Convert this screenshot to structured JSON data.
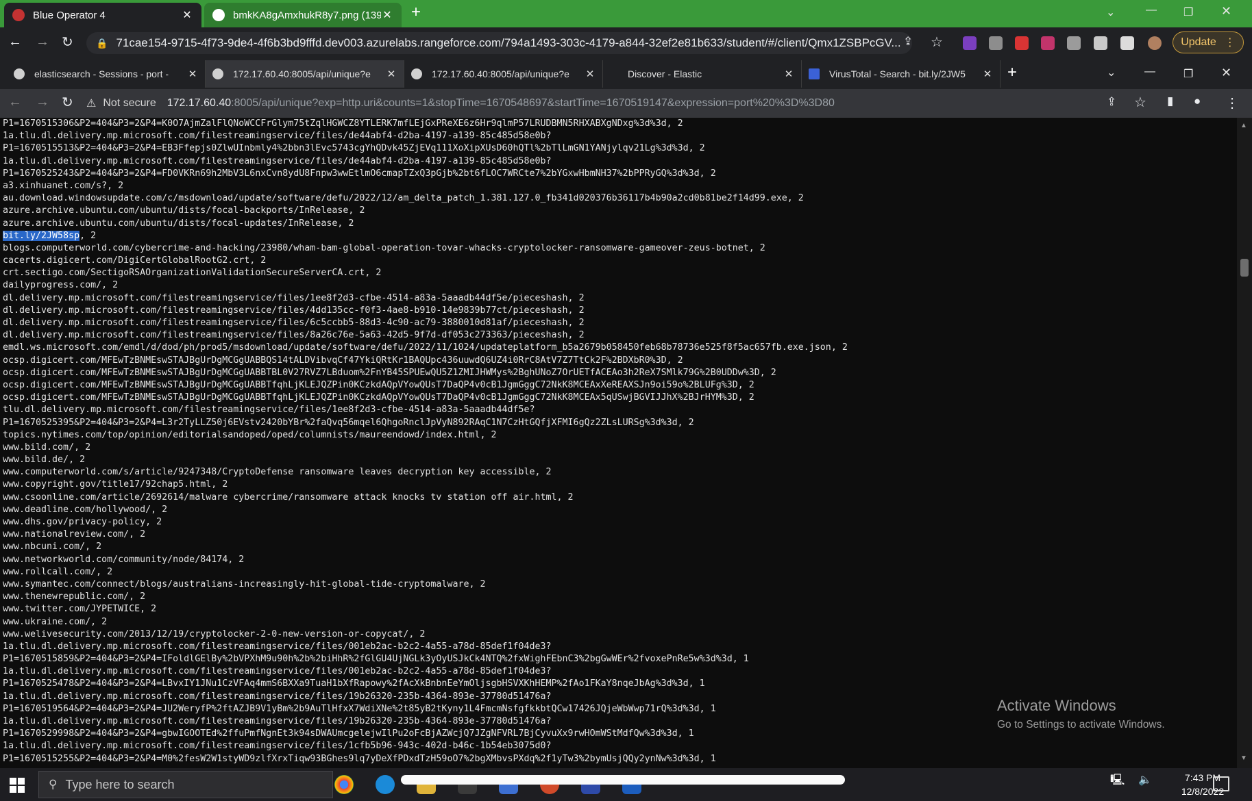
{
  "outer_browser": {
    "tabs": [
      {
        "title": "Blue Operator 4",
        "icon": "rangeforce-icon"
      },
      {
        "title": "bmkKA8gAmxhukR8y7.png (139",
        "icon": "image-icon"
      }
    ],
    "url": "71cae154-9715-4f73-9de4-4f6b3bd9fffd.dev003.azurelabs.rangeforce.com/794a1493-303c-4179-a844-32ef2e81b633/student/#/client/Qmx1ZSBPcGV...",
    "update_label": "Update"
  },
  "inner_browser": {
    "tabs": [
      {
        "title": "elasticsearch - Sessions - port -",
        "icon": "globe-icon"
      },
      {
        "title": "172.17.60.40:8005/api/unique?e",
        "icon": "globe-icon"
      },
      {
        "title": "172.17.60.40:8005/api/unique?e",
        "icon": "globe-icon"
      },
      {
        "title": "Discover - Elastic",
        "icon": "elastic-icon"
      },
      {
        "title": "VirusTotal - Search - bit.ly/2JW5",
        "icon": "virustotal-icon"
      }
    ],
    "security": "Not secure",
    "url_host": "172.17.60.40",
    "url_path": ":8005/api/unique?exp=http.uri&counts=1&stopTime=1670548697&startTime=1670519147&expression=port%20%3D%3D80"
  },
  "page": {
    "lines": [
      "P1=1670515306&P2=404&P3=2&P4=K0O7AjmZalFlQNoWCCFrGlym75tZqlHGWCZ8YTLERK7mfLEjGxPReXE6z6Hr9qlmP57LRUDBMN5RHXABXgNDxg%3d%3d, 2",
      "1a.tlu.dl.delivery.mp.microsoft.com/filestreamingservice/files/de44abf4-d2ba-4197-a139-85c485d58e0b?",
      "P1=1670515513&P2=404&P3=2&P4=EB3Ffepjs0ZlwUInbmly4%2bbn3lEvc5743cgYhQDvk45ZjEVq111XoXipXUsD60hQTl%2bTlLmGN1YANjylqv21Lg%3d%3d, 2",
      "1a.tlu.dl.delivery.mp.microsoft.com/filestreamingservice/files/de44abf4-d2ba-4197-a139-85c485d58e0b?",
      "P1=1670525243&P2=404&P3=2&P4=FD0VKRn69h2MbV3L6nxCvn8ydU8Fnpw3wwEtlmO6cmapTZxQ3pGjb%2bt6fLOC7WRCte7%2bYGxwHbmNH37%2bPPRyGQ%3d%3d, 2",
      "a3.xinhuanet.com/s?, 2",
      "au.download.windowsupdate.com/c/msdownload/update/software/defu/2022/12/am_delta_patch_1.381.127.0_fb341d020376b36117b4b90a2cd0b81be2f14d99.exe, 2",
      "azure.archive.ubuntu.com/ubuntu/dists/focal-backports/InRelease, 2",
      "azure.archive.ubuntu.com/ubuntu/dists/focal-updates/InRelease, 2",
      "bit.ly/2JW58sp",
      "blogs.computerworld.com/cybercrime-and-hacking/23980/wham-bam-global-operation-tovar-whacks-cryptolocker-ransomware-gameover-zeus-botnet, 2",
      "cacerts.digicert.com/DigiCertGlobalRootG2.crt, 2",
      "crt.sectigo.com/SectigoRSAOrganizationValidationSecureServerCA.crt, 2",
      "dailyprogress.com/, 2",
      "dl.delivery.mp.microsoft.com/filestreamingservice/files/1ee8f2d3-cfbe-4514-a83a-5aaadb44df5e/pieceshash, 2",
      "dl.delivery.mp.microsoft.com/filestreamingservice/files/4dd135cc-f0f3-4ae8-b910-14e9839b77ct/pieceshash, 2",
      "dl.delivery.mp.microsoft.com/filestreamingservice/files/6c5ccbb5-88d3-4c90-ac79-3880010d81af/pieceshash, 2",
      "dl.delivery.mp.microsoft.com/filestreamingservice/files/8a26c76e-5a63-42d5-9f7d-df053c273363/pieceshash, 2",
      "emdl.ws.microsoft.com/emdl/d/dod/ph/prod5/msdownload/update/software/defu/2022/11/1024/updateplatform_b5a2679b058450feb68b78736e525f8f5ac657fb.exe.json, 2",
      "ocsp.digicert.com/MFEwTzBNMEswSTAJBgUrDgMCGgUABBQS14tALDVibvqCf47YkiQRtKr1BAQUpc436uuwdQ6UZ4i0RrC8AtV7Z7TtCk2F%2BDXbR0%3D, 2",
      "ocsp.digicert.com/MFEwTzBNMEswSTAJBgUrDgMCGgUABBTBL0V27RVZ7LBduom%2FnYB45SPUEwQU5Z1ZMIJHWMys%2BghUNoZ7OrUETfACEAo3h2ReX7SMlk79G%2B0UDDw%3D, 2",
      "ocsp.digicert.com/MFEwTzBNMEswSTAJBgUrDgMCGgUABBTfqhLjKLEJQZPin0KCzkdAQpVYowQUsT7DaQP4v0cB1JgmGggC72NkK8MCEAxXeREAXSJn9oi59o%2BLUFg%3D, 2",
      "ocsp.digicert.com/MFEwTzBNMEswSTAJBgUrDgMCGgUABBTfqhLjKLEJQZPin0KCzkdAQpVYowQUsT7DaQP4v0cB1JgmGggC72NkK8MCEAx5qUSwjBGVIJJhX%2BJrHYM%3D, 2",
      "tlu.dl.delivery.mp.microsoft.com/filestreamingservice/files/1ee8f2d3-cfbe-4514-a83a-5aaadb44df5e?",
      "P1=1670525395&P2=404&P3=2&P4=L3r2TyLLZ50j6EVstv2420bYBr%2faQvq56mqel6QhgoRnclJpVyN892RAqC1N7CzHtGQfjXFMI6gQz2ZLsLURSg%3d%3d, 2",
      "topics.nytimes.com/top/opinion/editorialsandoped/oped/columnists/maureendowd/index.html, 2",
      "www.bild.com/, 2",
      "www.bild.de/, 2",
      "www.computerworld.com/s/article/9247348/CryptoDefense ransomware leaves decryption key accessible, 2",
      "www.copyright.gov/title17/92chap5.html, 2",
      "www.csoonline.com/article/2692614/malware cybercrime/ransomware attack knocks tv station off air.html, 2",
      "www.deadline.com/hollywood/, 2",
      "www.dhs.gov/privacy-policy, 2",
      "www.nationalreview.com/, 2",
      "www.nbcuni.com/, 2",
      "www.networkworld.com/community/node/84174, 2",
      "www.rollcall.com/, 2",
      "www.symantec.com/connect/blogs/australians-increasingly-hit-global-tide-cryptomalware, 2",
      "www.thenewrepublic.com/, 2",
      "www.twitter.com/JYPETWICE, 2",
      "www.ukraine.com/, 2",
      "www.welivesecurity.com/2013/12/19/cryptolocker-2-0-new-version-or-copycat/, 2",
      "1a.tlu.dl.delivery.mp.microsoft.com/filestreamingservice/files/001eb2ac-b2c2-4a55-a78d-85def1f04de3?",
      "P1=1670515859&P2=404&P3=2&P4=IFoldlGElBy%2bVPXhM9u90h%2b%2biHhR%2fGlGU4UjNGLk3yOyUSJkCk4NTQ%2fxWighFEbnC3%2bgGwWEr%2fvoxePnRe5w%3d%3d, 1",
      "1a.tlu.dl.delivery.mp.microsoft.com/filestreamingservice/files/001eb2ac-b2c2-4a55-a78d-85def1f04de3?",
      "P1=1670525478&P2=404&P3=2&P4=LBvxIY1JNu1CzVFAq4mmS6BXXa9TuaH1bXfRapowy%2fAcXkBnbnEeYmOljsgbHSVXKhHEMP%2fAo1FKaY8nqeJbAg%3d%3d, 1",
      "1a.tlu.dl.delivery.mp.microsoft.com/filestreamingservice/files/19b26320-235b-4364-893e-37780d51476a?",
      "P1=1670519564&P2=404&P3=2&P4=JU2WeryfP%2ftAZJB9V1yBm%2b9AuTlHfxX7WdiXNe%2t85yB2tKyny1L4FmcmNsfgfkkbtQCw17426JQjeWbWwp71rQ%3d%3d, 1",
      "1a.tlu.dl.delivery.mp.microsoft.com/filestreamingservice/files/19b26320-235b-4364-893e-37780d51476a?",
      "P1=1670529998&P2=404&P3=2&P4=gbwIGOOTEd%2ffuPmfNgnEt3k94sDWAUmcgelejwIlPu2oFcBjAZWcjQ7JZgNFVRL7BjCyvuXx9rwHOmWStMdfQw%3d%3d, 1",
      "1a.tlu.dl.delivery.mp.microsoft.com/filestreamingservice/files/1cfb5b96-943c-402d-b46c-1b54eb3075d0?",
      "P1=1670515255&P2=404&P3=2&P4=M0%2fesW2W1styWD9zlfXrxTiqw93BGhes9lq7yDeXfPDxdTzH59oO7%2bgXMbvsPXdq%2f1yTw3%2bymUsjQQy2ynNw%3d%3d, 1"
    ],
    "highlight_text": "bit.ly/2JW58sp",
    "highlight_suffix": ", 2"
  },
  "watermark": {
    "title": "Activate Windows",
    "subtitle": "Go to Settings to activate Windows."
  },
  "taskbar": {
    "search_placeholder": "Type here to search",
    "time": "7:43 PM",
    "date": "12/8/2022"
  }
}
